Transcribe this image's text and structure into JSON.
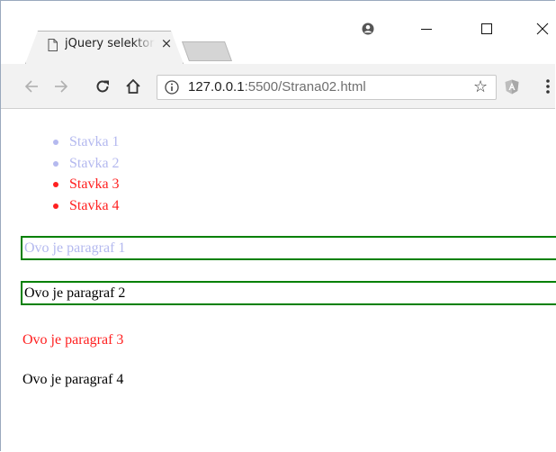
{
  "tab": {
    "title": "jQuery selektori",
    "close_glyph": "×"
  },
  "window_controls": {
    "profile_glyph": "●",
    "minimize_glyph": "—",
    "maximize_glyph": "□",
    "close_glyph": "✕"
  },
  "address_bar": {
    "url_host": "127.0.0.1",
    "url_rest": ":5500/Strana02.html"
  },
  "icons": {
    "back": "back-arrow-icon",
    "forward": "forward-arrow-icon",
    "reload": "reload-icon",
    "home": "home-icon",
    "info": "info-icon",
    "bookmark": "star-icon",
    "extension": "angular-extension-icon",
    "menu": "kebab-menu-icon"
  },
  "colors": {
    "list_highlight": "#b4b9ef",
    "red": "#ff2020",
    "border_green": "#008000",
    "black": "#000000"
  },
  "list": [
    {
      "label": "Stavka 1",
      "color": "#b4b9ef"
    },
    {
      "label": "Stavka 2",
      "color": "#b4b9ef"
    },
    {
      "label": "Stavka 3",
      "color": "#ff2020"
    },
    {
      "label": "Stavka 4",
      "color": "#ff2020"
    }
  ],
  "paragraphs": [
    {
      "text": "Ovo je paragraf 1",
      "color": "#b4b9ef",
      "bordered": true
    },
    {
      "text": "Ovo je paragraf 2",
      "color": "#000000",
      "bordered": true
    },
    {
      "text": "Ovo je paragraf 3",
      "color": "#ff2020",
      "bordered": false
    },
    {
      "text": "Ovo je paragraf 4",
      "color": "#000000",
      "bordered": false
    }
  ]
}
